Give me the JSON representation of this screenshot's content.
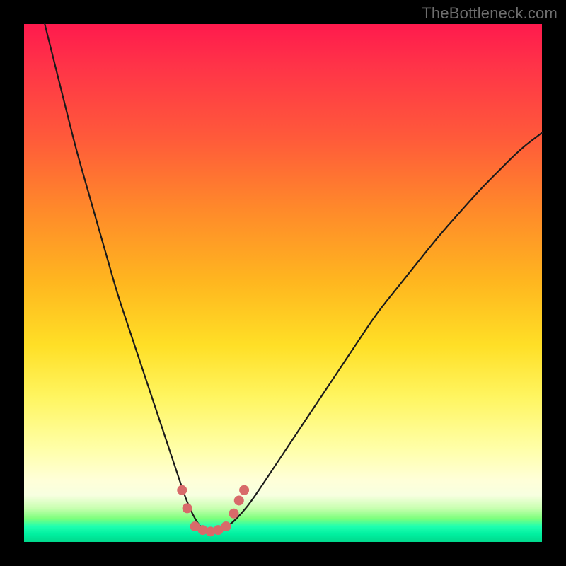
{
  "watermark": "TheBottleneck.com",
  "chart_data": {
    "type": "line",
    "title": "",
    "xlabel": "",
    "ylabel": "",
    "xlim": [
      0,
      100
    ],
    "ylim": [
      0,
      100
    ],
    "grid": false,
    "legend": false,
    "series": [
      {
        "name": "bottleneck-curve",
        "x": [
          4,
          6,
          8,
          10,
          12,
          14,
          16,
          18,
          20,
          22,
          24,
          26,
          28,
          30,
          31,
          32,
          33,
          34,
          35,
          36,
          37,
          38,
          40,
          42,
          44,
          48,
          52,
          56,
          60,
          64,
          68,
          72,
          76,
          80,
          84,
          88,
          92,
          96,
          100
        ],
        "y": [
          100,
          92,
          84,
          76,
          69,
          62,
          55,
          48,
          42,
          36,
          30,
          24,
          18,
          12,
          9,
          6.5,
          4.5,
          3,
          2.2,
          2,
          2,
          2.2,
          3.5,
          5.5,
          8,
          14,
          20,
          26,
          32,
          38,
          44,
          49,
          54,
          59,
          63.5,
          68,
          72,
          76,
          79
        ]
      }
    ],
    "markers": {
      "name": "highlighted-points",
      "color": "#d86a6a",
      "points": [
        {
          "x": 30.5,
          "y": 10
        },
        {
          "x": 31.5,
          "y": 6.5
        },
        {
          "x": 33.0,
          "y": 3
        },
        {
          "x": 34.5,
          "y": 2.3
        },
        {
          "x": 36.0,
          "y": 2
        },
        {
          "x": 37.5,
          "y": 2.3
        },
        {
          "x": 39.0,
          "y": 3
        },
        {
          "x": 40.5,
          "y": 5.5
        },
        {
          "x": 41.5,
          "y": 8
        },
        {
          "x": 42.5,
          "y": 10
        }
      ]
    }
  }
}
